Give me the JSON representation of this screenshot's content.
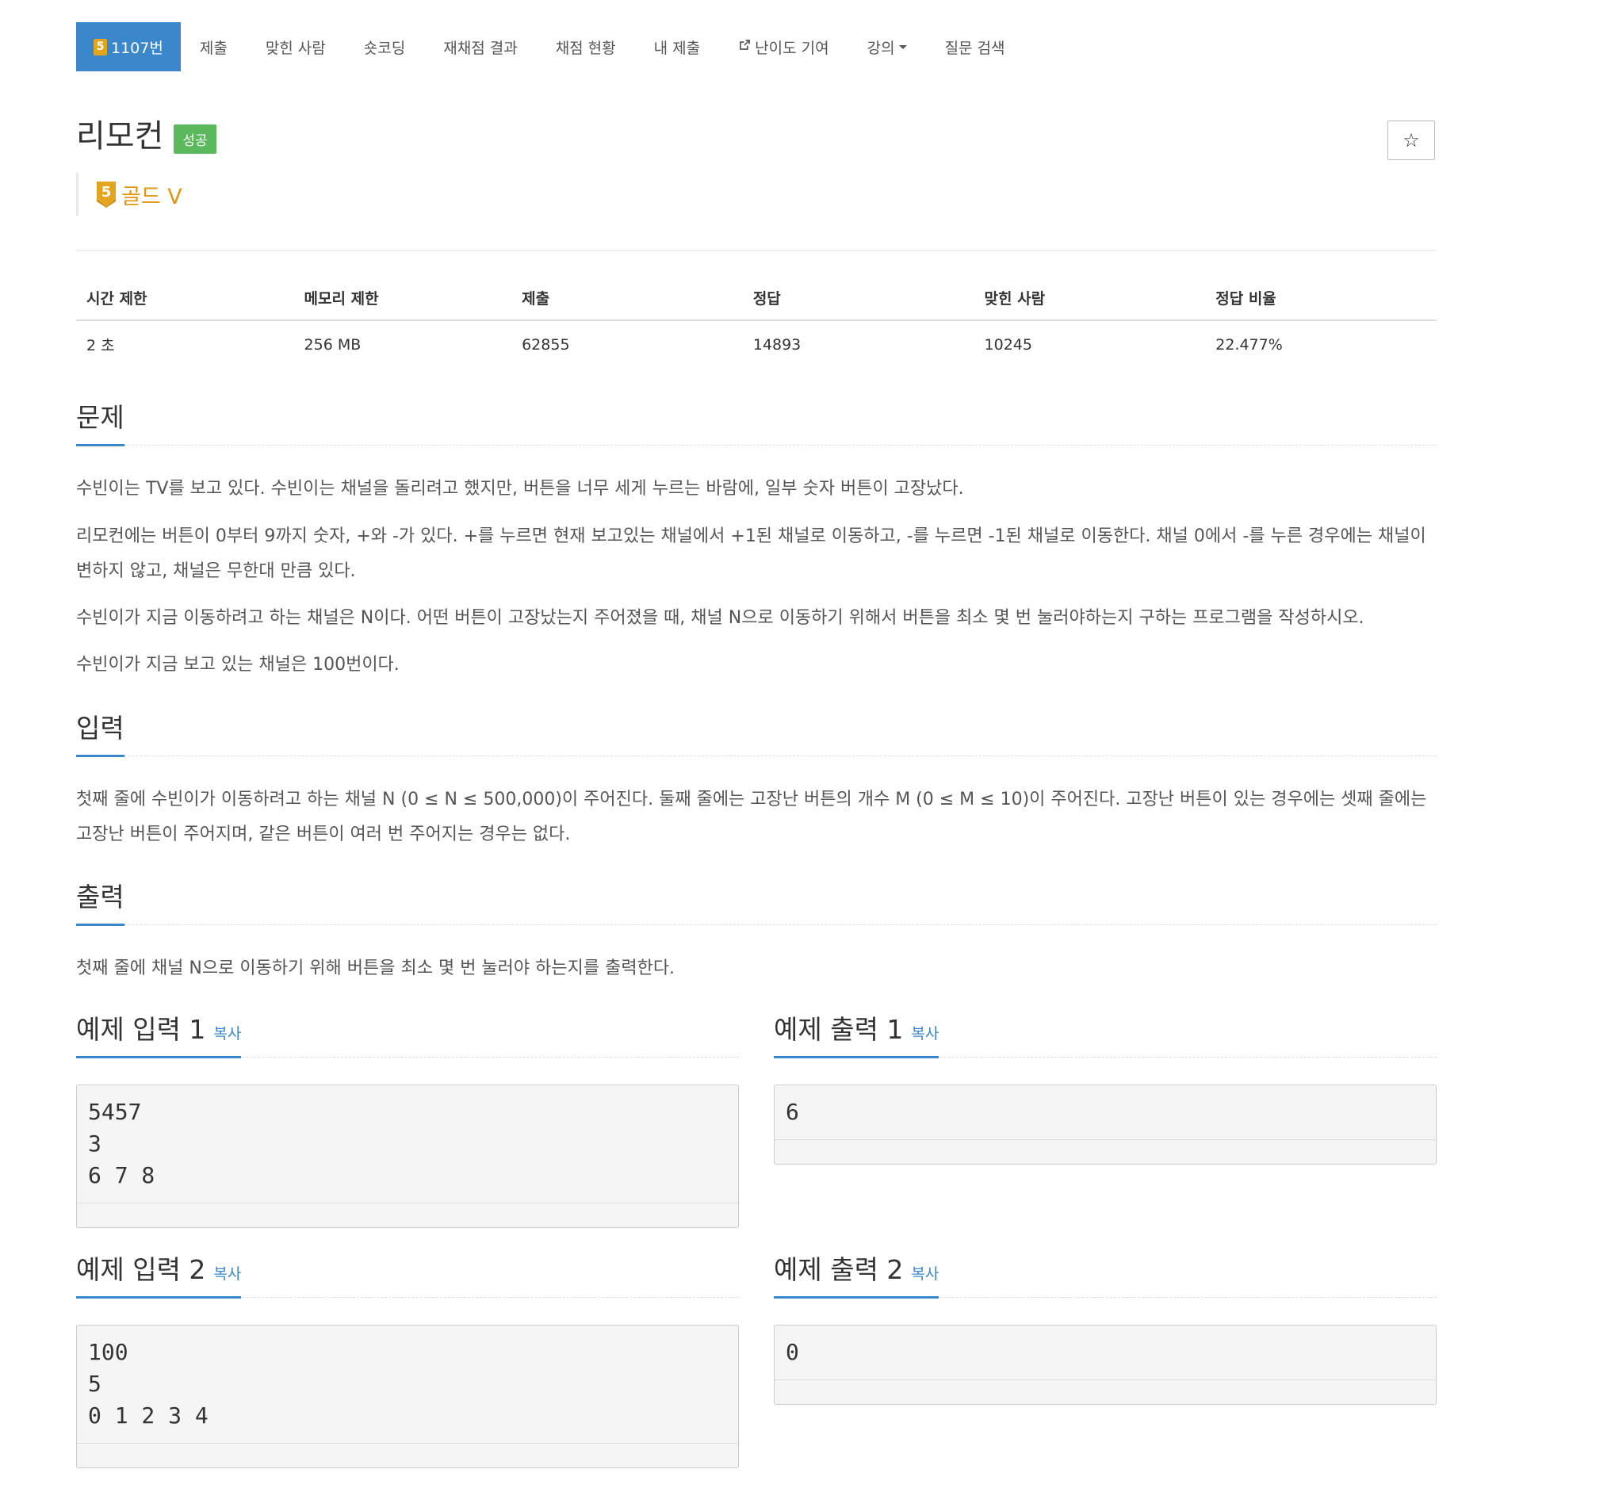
{
  "nav": {
    "problem_tier_digit": "5",
    "items": [
      "1107번",
      "제출",
      "맞힌 사람",
      "숏코딩",
      "재채점 결과",
      "채점 현황",
      "내 제출",
      "난이도 기여",
      "강의",
      "질문 검색"
    ]
  },
  "problem": {
    "title": "리모컨",
    "status_badge": "성공",
    "tier_digit": "5",
    "tier_label": "골드 V",
    "star_icon": "☆"
  },
  "info_table": {
    "headers": [
      "시간 제한",
      "메모리 제한",
      "제출",
      "정답",
      "맞힌 사람",
      "정답 비율"
    ],
    "values": [
      "2 초",
      "256 MB",
      "62855",
      "14893",
      "10245",
      "22.477%"
    ]
  },
  "sections": {
    "problem": {
      "title": "문제",
      "paragraphs": [
        "수빈이는 TV를 보고 있다. 수빈이는 채널을 돌리려고 했지만, 버튼을 너무 세게 누르는 바람에, 일부 숫자 버튼이 고장났다.",
        "리모컨에는 버튼이 0부터 9까지 숫자, +와 -가 있다. +를 누르면 현재 보고있는 채널에서 +1된 채널로 이동하고, -를 누르면 -1된 채널로 이동한다. 채널 0에서 -를 누른 경우에는 채널이 변하지 않고, 채널은 무한대 만큼 있다.",
        "수빈이가 지금 이동하려고 하는 채널은 N이다. 어떤 버튼이 고장났는지 주어졌을 때, 채널 N으로 이동하기 위해서 버튼을 최소 몇 번 눌러야하는지 구하는 프로그램을 작성하시오.",
        "수빈이가 지금 보고 있는 채널은 100번이다."
      ]
    },
    "input": {
      "title": "입력",
      "text": "첫째 줄에 수빈이가 이동하려고 하는 채널 N (0 ≤ N ≤ 500,000)이 주어진다.  둘째 줄에는 고장난 버튼의 개수 M (0 ≤ M ≤ 10)이 주어진다. 고장난 버튼이 있는 경우에는 셋째 줄에는 고장난 버튼이 주어지며, 같은 버튼이 여러 번 주어지는 경우는 없다."
    },
    "output": {
      "title": "출력",
      "text": "첫째 줄에 채널 N으로 이동하기 위해 버튼을 최소 몇 번 눌러야 하는지를 출력한다."
    }
  },
  "samples": {
    "copy_label": "복사",
    "input1": {
      "title": "예제 입력 1",
      "content": "5457\n3\n6 7 8"
    },
    "output1": {
      "title": "예제 출력 1",
      "content": "6"
    },
    "input2": {
      "title": "예제 입력 2",
      "content": "100\n5\n0 1 2 3 4"
    },
    "output2": {
      "title": "예제 출력 2",
      "content": "0"
    }
  },
  "colors": {
    "accent": "#3a87cc",
    "success": "#5cb85c",
    "gold": "#e3960d"
  }
}
